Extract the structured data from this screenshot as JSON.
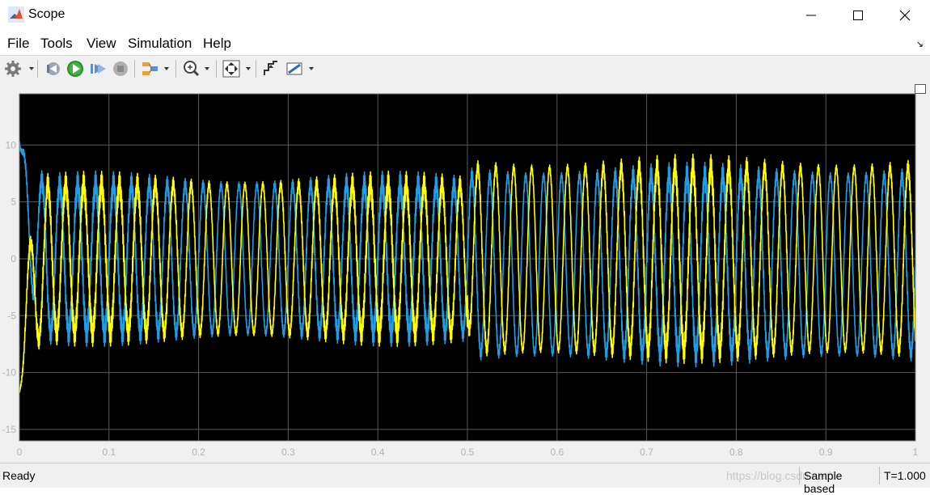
{
  "window": {
    "title": "Scope"
  },
  "menu": {
    "items": [
      "File",
      "Tools",
      "View",
      "Simulation",
      "Help"
    ]
  },
  "toolbar": {
    "icons": [
      "gear-icon",
      "step-back-icon",
      "run-icon",
      "step-forward-icon",
      "stop-icon",
      "signal-selector-icon",
      "zoom-icon",
      "autoscale-icon",
      "triggers-icon",
      "measurements-icon"
    ]
  },
  "status": {
    "ready": "Ready",
    "mode": "Sample based",
    "time": "T=1.000",
    "watermark": "https://blog.csdn.net/..."
  },
  "colors": {
    "plot_bg": "#000000",
    "grid": "#5a5a5a",
    "series1": "#1f9de6",
    "series2": "#ffff00",
    "axis_text": "#b4b4b4"
  },
  "chart_data": {
    "type": "line",
    "xlabel": "",
    "ylabel": "",
    "xlim": [
      0,
      1
    ],
    "ylim": [
      -16,
      14.5
    ],
    "xticks": [
      "0",
      "0.1",
      "0.2",
      "0.3",
      "0.4",
      "0.5",
      "0.6",
      "0.7",
      "0.8",
      "0.9",
      "1"
    ],
    "yticks": [
      "10",
      "5",
      "0",
      "-5",
      "-10",
      "-15"
    ],
    "xtick_values": [
      0,
      0.1,
      0.2,
      0.3,
      0.4,
      0.5,
      0.6,
      0.7,
      0.8,
      0.9,
      1
    ],
    "ytick_values": [
      10,
      5,
      0,
      -5,
      -10,
      -15
    ],
    "grid": true,
    "series": [
      {
        "color": "#1f9de6",
        "frequency_hz": 50,
        "amplitude_before": 6.5,
        "amplitude_after": 7.8,
        "offset_before": 0,
        "offset_after": -0.5,
        "step_time": 0.5,
        "phase_deg": 0,
        "startup_peak": 11.5,
        "ripple": 1.2
      },
      {
        "color": "#ffff00",
        "frequency_hz": 50,
        "amplitude_before": 6.5,
        "amplitude_after": 8.0,
        "offset_before": 0,
        "offset_after": 0,
        "step_time": 0.5,
        "phase_deg": -120,
        "startup_peak": -12.5,
        "ripple": 1.2
      }
    ]
  }
}
